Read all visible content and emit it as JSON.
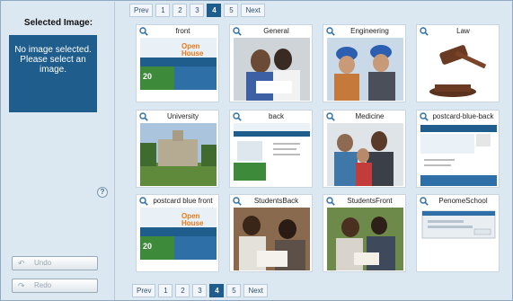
{
  "left": {
    "title": "Selected Image:",
    "preview_text": "No image selected.\nPlease select an\nimage.",
    "undo_label": "Undo",
    "redo_label": "Redo",
    "help_label": "?"
  },
  "pager": {
    "prev": "Prev",
    "pages": [
      "1",
      "2",
      "3",
      "4",
      "5"
    ],
    "active_page": "4",
    "next": "Next"
  },
  "tiles": [
    {
      "caption": "front",
      "kind": "brochure"
    },
    {
      "caption": "General",
      "kind": "people"
    },
    {
      "caption": "Engineering",
      "kind": "engineers"
    },
    {
      "caption": "Law",
      "kind": "gavel"
    },
    {
      "caption": "University",
      "kind": "building"
    },
    {
      "caption": "back",
      "kind": "doc"
    },
    {
      "caption": "Medicine",
      "kind": "people2"
    },
    {
      "caption": "postcard-blue-back",
      "kind": "doc2"
    },
    {
      "caption": "postcard blue front",
      "kind": "brochure"
    },
    {
      "caption": "StudentsBack",
      "kind": "students"
    },
    {
      "caption": "StudentsFront",
      "kind": "students2"
    },
    {
      "caption": "PenomeSchool",
      "kind": "screenshot"
    }
  ],
  "colors": {
    "accent": "#1f5d8c",
    "panel_bg": "#dbe7f1"
  },
  "icons": {
    "tile_icon": "magnifier-icon",
    "undo_icon": "undo-arrow-icon",
    "redo_icon": "redo-arrow-icon",
    "help_icon": "help-icon"
  }
}
